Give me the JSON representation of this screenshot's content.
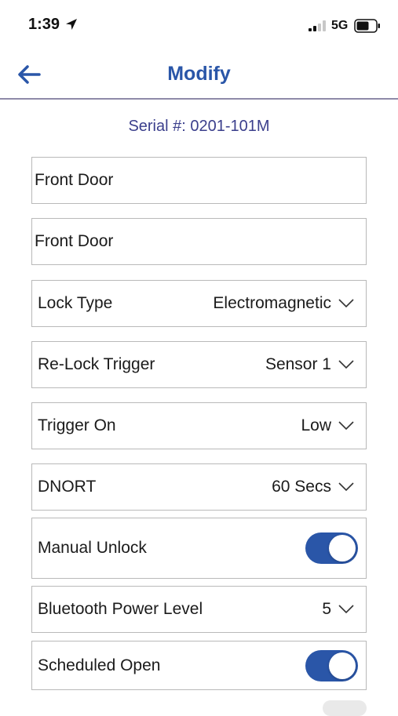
{
  "status_bar": {
    "time": "1:39",
    "network": "5G"
  },
  "header": {
    "title": "Modify"
  },
  "serial": "Serial #: 0201-101M",
  "fields": {
    "name": "Front Door",
    "description": "Front Door"
  },
  "rows": {
    "lock_type": {
      "label": "Lock Type",
      "value": "Electromagnetic"
    },
    "relock_trigger": {
      "label": "Re-Lock Trigger",
      "value": "Sensor 1"
    },
    "trigger_on": {
      "label": "Trigger On",
      "value": "Low"
    },
    "dnort": {
      "label": "DNORT",
      "value": "60 Secs"
    },
    "manual_unlock": {
      "label": "Manual Unlock",
      "enabled": true
    },
    "bluetooth_power": {
      "label": "Bluetooth Power Level",
      "value": "5"
    },
    "scheduled_open": {
      "label": "Scheduled Open",
      "enabled": true
    }
  },
  "colors": {
    "accent": "#2a56a8",
    "serial_text": "#3b3f8c",
    "border": "#b9b9b9"
  }
}
